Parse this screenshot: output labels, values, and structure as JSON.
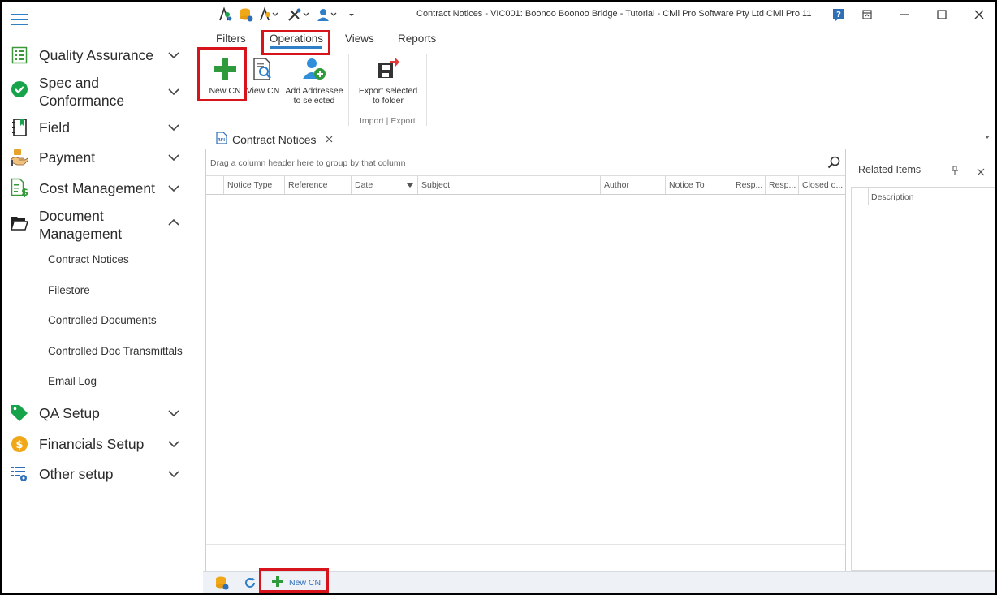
{
  "window": {
    "title": "Contract Notices - VIC001: Boonoo Boonoo Bridge - Tutorial - Civil Pro Software Pty Ltd Civil Pro 11"
  },
  "sidebar": {
    "items": [
      {
        "label": "Quality Assurance",
        "icon": "clipboard-list-icon",
        "state": "collapsed"
      },
      {
        "label": "Spec and Conformance",
        "line1": "Spec and",
        "line2": "Conformance",
        "icon": "check-circle-icon",
        "state": "collapsed"
      },
      {
        "label": "Field",
        "icon": "notebook-icon",
        "state": "collapsed"
      },
      {
        "label": "Payment",
        "icon": "hand-money-icon",
        "state": "collapsed"
      },
      {
        "label": "Cost Management",
        "icon": "document-dollar-icon",
        "state": "collapsed"
      },
      {
        "label": "Document Management",
        "line1": "Document",
        "line2": "Management",
        "icon": "open-folder-icon",
        "state": "expanded"
      },
      {
        "label": "QA Setup",
        "icon": "tag-icon",
        "state": "collapsed"
      },
      {
        "label": "Financials Setup",
        "icon": "coin-icon",
        "state": "collapsed"
      },
      {
        "label": "Other setup",
        "icon": "list-gear-icon",
        "state": "collapsed"
      }
    ],
    "sub_items": [
      "Contract Notices",
      "Filestore",
      "Controlled Documents",
      "Controlled Doc Transmittals",
      "Email Log"
    ]
  },
  "ribbon": {
    "tabs": [
      "Filters",
      "Operations",
      "Views",
      "Reports"
    ],
    "active_tab": "Operations",
    "buttons": [
      {
        "label1": "New CN",
        "label2": ""
      },
      {
        "label1": "View CN",
        "label2": ""
      },
      {
        "label1": "Add Addressee",
        "label2": "to selected"
      },
      {
        "label1": "Export selected",
        "label2": "to folder"
      }
    ],
    "group_label": "Import | Export"
  },
  "document_tab": {
    "label": "Contract Notices"
  },
  "grid": {
    "group_hint": "Drag a column header here to group by that column",
    "columns": [
      "Notice Type",
      "Reference",
      "Date",
      "Subject",
      "Author",
      "Notice To",
      "Resp...",
      "Resp...",
      "Closed o..."
    ]
  },
  "related": {
    "title": "Related Items",
    "column": "Description"
  },
  "statusbar": {
    "new_label": "New CN"
  },
  "colors": {
    "accent": "#2f7fc8",
    "green": "#2e9a3b",
    "highlight": "#d7141b"
  }
}
